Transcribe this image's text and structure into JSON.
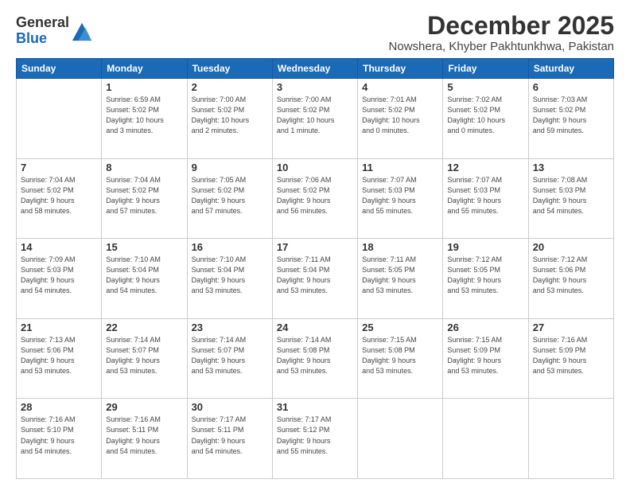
{
  "header": {
    "logo_general": "General",
    "logo_blue": "Blue",
    "title": "December 2025",
    "subtitle": "Nowshera, Khyber Pakhtunkhwa, Pakistan"
  },
  "days_of_week": [
    "Sunday",
    "Monday",
    "Tuesday",
    "Wednesday",
    "Thursday",
    "Friday",
    "Saturday"
  ],
  "weeks": [
    [
      {
        "day": "",
        "info": ""
      },
      {
        "day": "1",
        "info": "Sunrise: 6:59 AM\nSunset: 5:02 PM\nDaylight: 10 hours\nand 3 minutes."
      },
      {
        "day": "2",
        "info": "Sunrise: 7:00 AM\nSunset: 5:02 PM\nDaylight: 10 hours\nand 2 minutes."
      },
      {
        "day": "3",
        "info": "Sunrise: 7:00 AM\nSunset: 5:02 PM\nDaylight: 10 hours\nand 1 minute."
      },
      {
        "day": "4",
        "info": "Sunrise: 7:01 AM\nSunset: 5:02 PM\nDaylight: 10 hours\nand 0 minutes."
      },
      {
        "day": "5",
        "info": "Sunrise: 7:02 AM\nSunset: 5:02 PM\nDaylight: 10 hours\nand 0 minutes."
      },
      {
        "day": "6",
        "info": "Sunrise: 7:03 AM\nSunset: 5:02 PM\nDaylight: 9 hours\nand 59 minutes."
      }
    ],
    [
      {
        "day": "7",
        "info": "Sunrise: 7:04 AM\nSunset: 5:02 PM\nDaylight: 9 hours\nand 58 minutes."
      },
      {
        "day": "8",
        "info": "Sunrise: 7:04 AM\nSunset: 5:02 PM\nDaylight: 9 hours\nand 57 minutes."
      },
      {
        "day": "9",
        "info": "Sunrise: 7:05 AM\nSunset: 5:02 PM\nDaylight: 9 hours\nand 57 minutes."
      },
      {
        "day": "10",
        "info": "Sunrise: 7:06 AM\nSunset: 5:02 PM\nDaylight: 9 hours\nand 56 minutes."
      },
      {
        "day": "11",
        "info": "Sunrise: 7:07 AM\nSunset: 5:03 PM\nDaylight: 9 hours\nand 55 minutes."
      },
      {
        "day": "12",
        "info": "Sunrise: 7:07 AM\nSunset: 5:03 PM\nDaylight: 9 hours\nand 55 minutes."
      },
      {
        "day": "13",
        "info": "Sunrise: 7:08 AM\nSunset: 5:03 PM\nDaylight: 9 hours\nand 54 minutes."
      }
    ],
    [
      {
        "day": "14",
        "info": "Sunrise: 7:09 AM\nSunset: 5:03 PM\nDaylight: 9 hours\nand 54 minutes."
      },
      {
        "day": "15",
        "info": "Sunrise: 7:10 AM\nSunset: 5:04 PM\nDaylight: 9 hours\nand 54 minutes."
      },
      {
        "day": "16",
        "info": "Sunrise: 7:10 AM\nSunset: 5:04 PM\nDaylight: 9 hours\nand 53 minutes."
      },
      {
        "day": "17",
        "info": "Sunrise: 7:11 AM\nSunset: 5:04 PM\nDaylight: 9 hours\nand 53 minutes."
      },
      {
        "day": "18",
        "info": "Sunrise: 7:11 AM\nSunset: 5:05 PM\nDaylight: 9 hours\nand 53 minutes."
      },
      {
        "day": "19",
        "info": "Sunrise: 7:12 AM\nSunset: 5:05 PM\nDaylight: 9 hours\nand 53 minutes."
      },
      {
        "day": "20",
        "info": "Sunrise: 7:12 AM\nSunset: 5:06 PM\nDaylight: 9 hours\nand 53 minutes."
      }
    ],
    [
      {
        "day": "21",
        "info": "Sunrise: 7:13 AM\nSunset: 5:06 PM\nDaylight: 9 hours\nand 53 minutes."
      },
      {
        "day": "22",
        "info": "Sunrise: 7:14 AM\nSunset: 5:07 PM\nDaylight: 9 hours\nand 53 minutes."
      },
      {
        "day": "23",
        "info": "Sunrise: 7:14 AM\nSunset: 5:07 PM\nDaylight: 9 hours\nand 53 minutes."
      },
      {
        "day": "24",
        "info": "Sunrise: 7:14 AM\nSunset: 5:08 PM\nDaylight: 9 hours\nand 53 minutes."
      },
      {
        "day": "25",
        "info": "Sunrise: 7:15 AM\nSunset: 5:08 PM\nDaylight: 9 hours\nand 53 minutes."
      },
      {
        "day": "26",
        "info": "Sunrise: 7:15 AM\nSunset: 5:09 PM\nDaylight: 9 hours\nand 53 minutes."
      },
      {
        "day": "27",
        "info": "Sunrise: 7:16 AM\nSunset: 5:09 PM\nDaylight: 9 hours\nand 53 minutes."
      }
    ],
    [
      {
        "day": "28",
        "info": "Sunrise: 7:16 AM\nSunset: 5:10 PM\nDaylight: 9 hours\nand 54 minutes."
      },
      {
        "day": "29",
        "info": "Sunrise: 7:16 AM\nSunset: 5:11 PM\nDaylight: 9 hours\nand 54 minutes."
      },
      {
        "day": "30",
        "info": "Sunrise: 7:17 AM\nSunset: 5:11 PM\nDaylight: 9 hours\nand 54 minutes."
      },
      {
        "day": "31",
        "info": "Sunrise: 7:17 AM\nSunset: 5:12 PM\nDaylight: 9 hours\nand 55 minutes."
      },
      {
        "day": "",
        "info": ""
      },
      {
        "day": "",
        "info": ""
      },
      {
        "day": "",
        "info": ""
      }
    ]
  ]
}
